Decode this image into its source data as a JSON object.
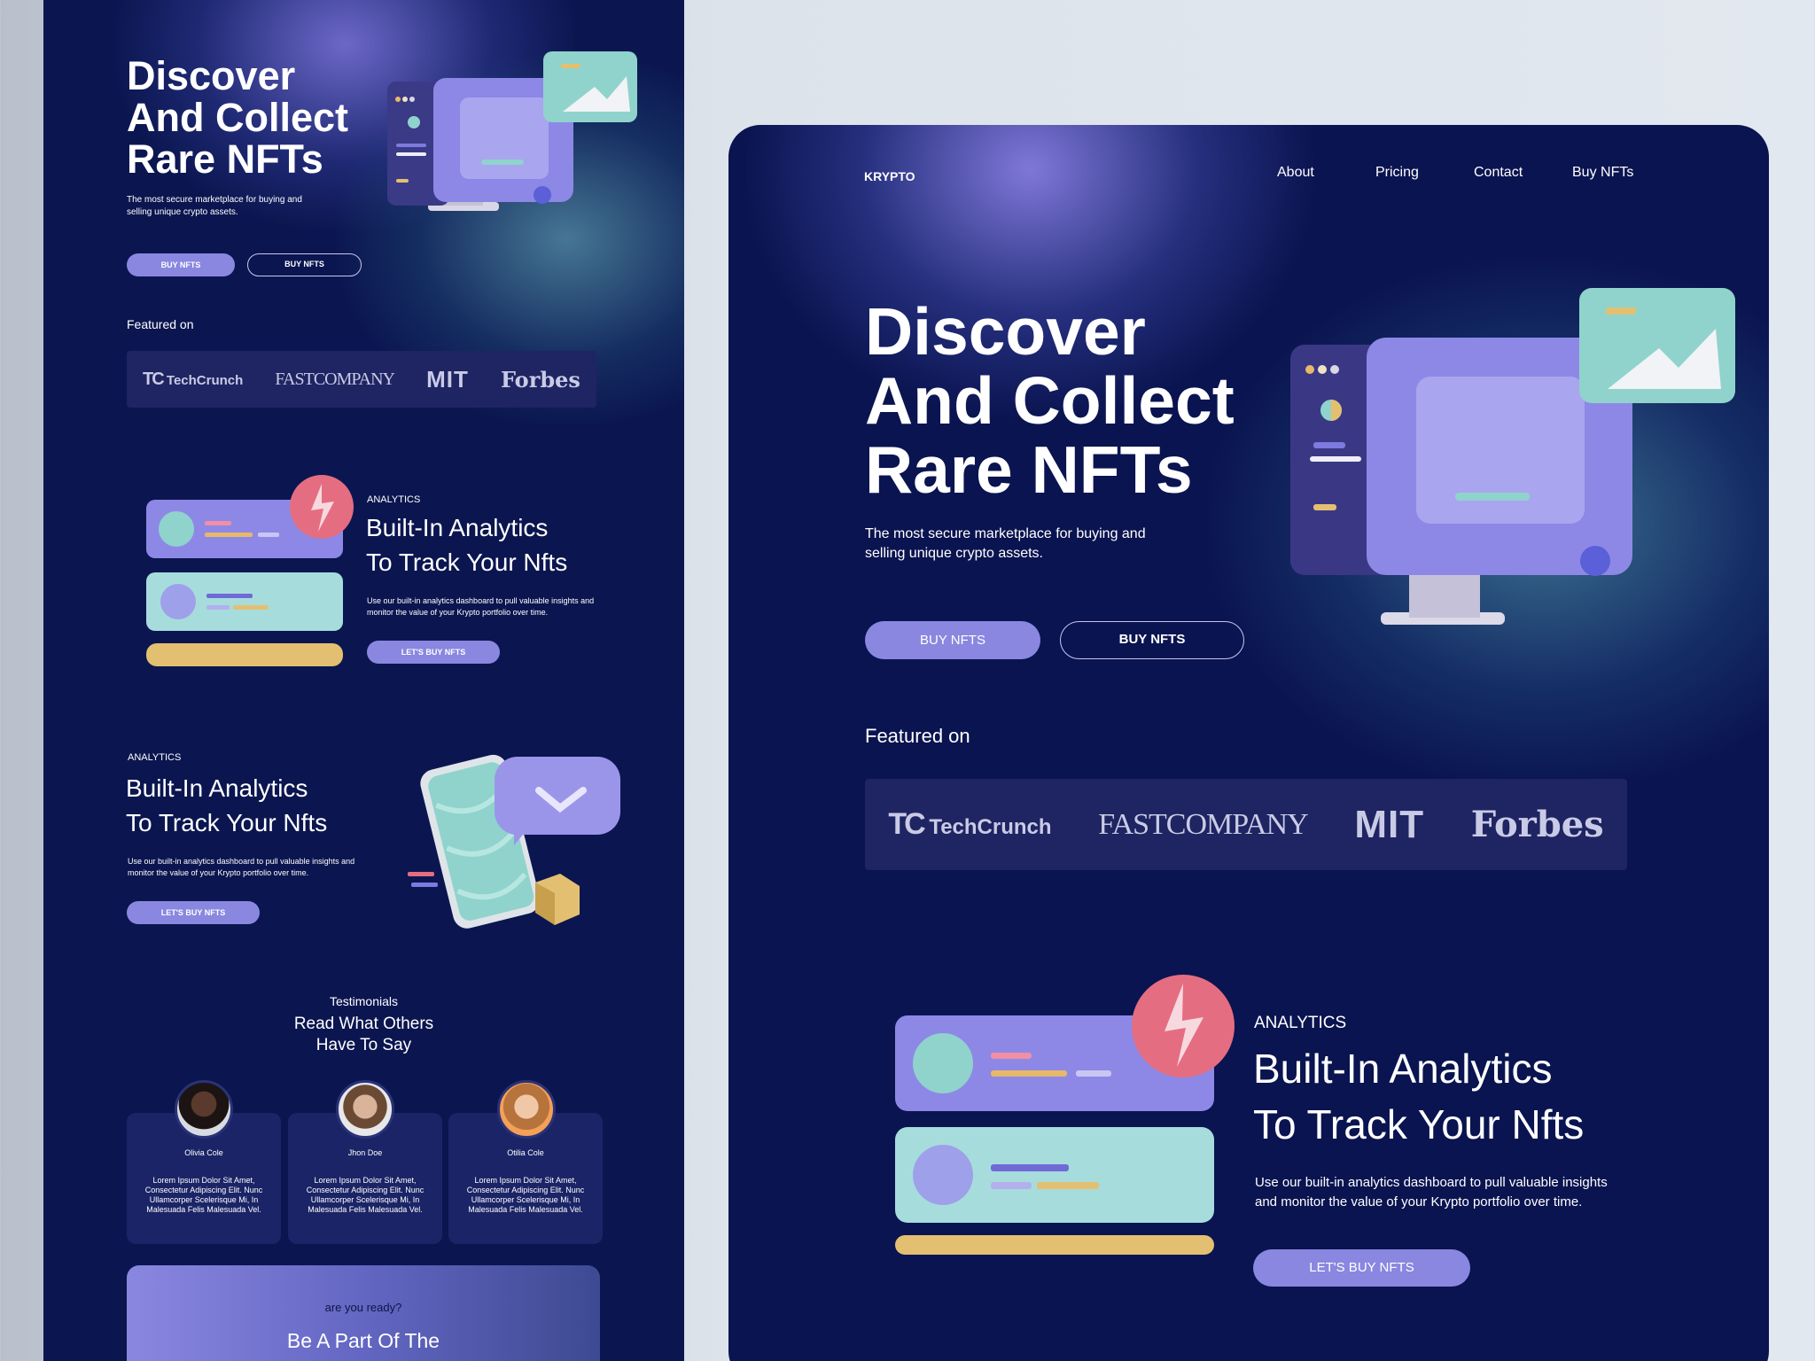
{
  "brand": {
    "logo": "KRYPTO"
  },
  "nav": {
    "items": [
      "About",
      "Pricing",
      "Contact",
      "Buy NFTs"
    ]
  },
  "hero": {
    "title_lines": [
      "Discover",
      "And Collect",
      "Rare NFTs"
    ],
    "subtitle": "The most secure marketplace for buying and selling unique crypto assets.",
    "btn_primary": "BUY NFTS",
    "btn_secondary": "BUY NFTS"
  },
  "featured": {
    "label": "Featured on",
    "logos": [
      "TechCrunch",
      "FASTCOMPANY",
      "MIT",
      "Forbes"
    ]
  },
  "analytics": {
    "kicker": "ANALYTICS",
    "title_lines": [
      "Built-In Analytics",
      "To Track Your Nfts"
    ],
    "body": "Use our built-in analytics dashboard to pull valuable insights and monitor the value of your Krypto portfolio over time.",
    "btn": "LET'S BUY NFTS"
  },
  "analytics_mobile": {
    "kicker": "ANALYTICS",
    "title_lines": [
      "Built-In Analytics",
      "To Track Your Nfts"
    ],
    "body": "Use our built-in analytics dashboard to pull valuable insights and monitor the value of your Krypto portfolio over time.",
    "btn": "LET'S BUY NFTS"
  },
  "testimonials": {
    "kicker": "Testimonials",
    "title_lines": [
      "Read What Others",
      "Have To Say"
    ],
    "items": [
      {
        "name": "Olivia Cole",
        "text": "Lorem Ipsum Dolor Sit Amet, Consectetur Adipiscing Elit. Nunc Ullamcorper Scelerisque Mi, In Malesuada Felis Malesuada Vel."
      },
      {
        "name": "Jhon Doe",
        "text": "Lorem Ipsum Dolor Sit Amet, Consectetur Adipiscing Elit. Nunc Ullamcorper Scelerisque Mi, In Malesuada Felis Malesuada Vel."
      },
      {
        "name": "Otilia Cole",
        "text": "Lorem Ipsum Dolor Sit Amet, Consectetur Adipiscing Elit. Nunc Ullamcorper Scelerisque Mi, In Malesuada Felis Malesuada Vel."
      }
    ]
  },
  "cta": {
    "kicker": "are you ready?",
    "title": "Be A Part Of The"
  },
  "colors": {
    "page_bg": "#0a1450",
    "accent": "#8a87e0",
    "teal": "#8fd3cc",
    "gold": "#e3c071"
  }
}
